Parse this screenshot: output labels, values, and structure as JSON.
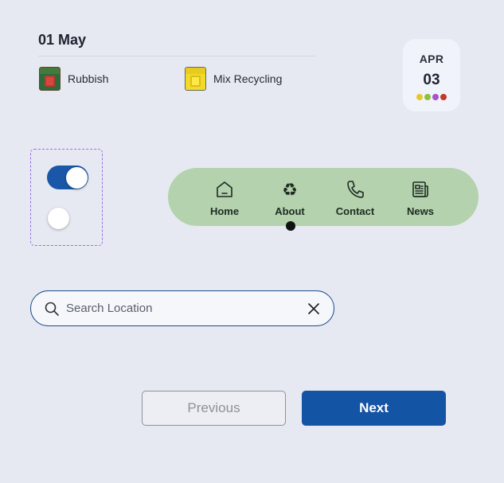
{
  "collection": {
    "date": "01 May",
    "bins": [
      {
        "label": "Rubbish",
        "icon": "red-bin-icon"
      },
      {
        "label": "Mix Recycling",
        "icon": "yellow-bin-icon"
      }
    ]
  },
  "calendar": {
    "month": "APR",
    "day": "03",
    "dot_colors": [
      "#e7c82a",
      "#8cc13f",
      "#a355c9",
      "#c0392b"
    ]
  },
  "toggles": [
    {
      "state": "on",
      "accent": "#1a57a8"
    },
    {
      "state": "off"
    }
  ],
  "nav": {
    "items": [
      {
        "label": "Home",
        "icon": "home-icon"
      },
      {
        "label": "About",
        "icon": "recycle-icon",
        "active": true
      },
      {
        "label": "Contact",
        "icon": "phone-icon"
      },
      {
        "label": "News",
        "icon": "newspaper-icon"
      }
    ],
    "background": "#b3d2ad"
  },
  "search": {
    "placeholder": "Search Location",
    "value": ""
  },
  "pagination": {
    "previous_label": "Previous",
    "next_label": "Next",
    "next_color": "#1454a5"
  }
}
